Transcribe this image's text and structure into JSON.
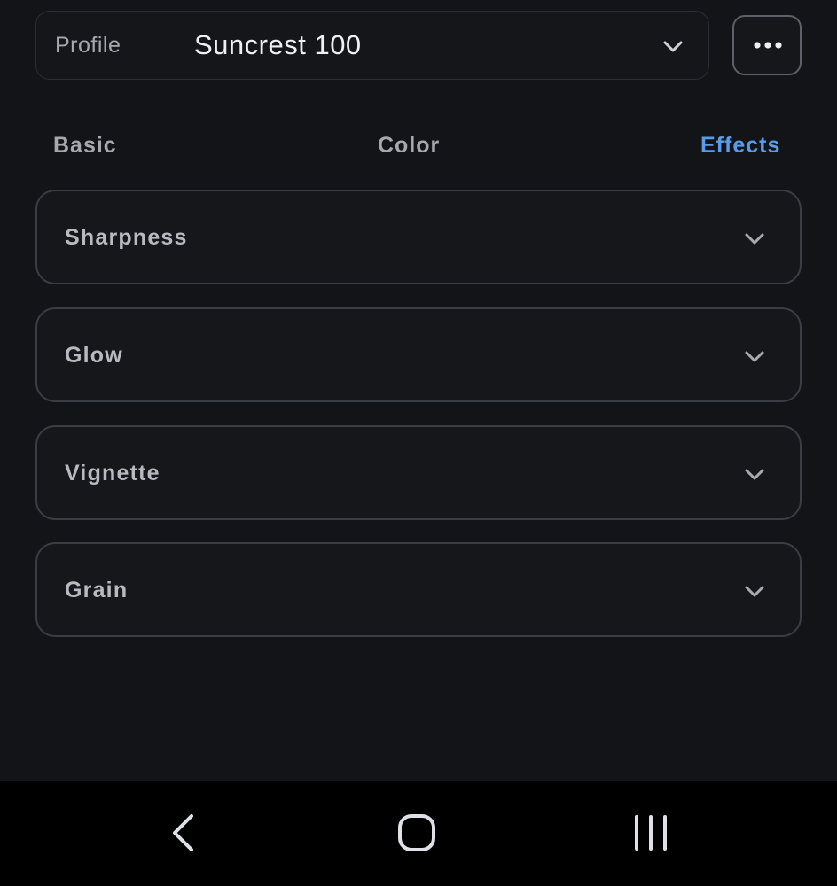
{
  "profile": {
    "label": "Profile",
    "value": "Suncrest 100",
    "more_icon": "more-horizontal-icon"
  },
  "tabs": [
    {
      "label": "Basic",
      "active": false
    },
    {
      "label": "Color",
      "active": false
    },
    {
      "label": "Effects",
      "active": true
    }
  ],
  "sections": [
    {
      "title": "Sharpness",
      "icon": "chevron-down-icon"
    },
    {
      "title": "Glow",
      "icon": "chevron-down-icon"
    },
    {
      "title": "Vignette",
      "icon": "chevron-down-icon"
    },
    {
      "title": "Grain",
      "icon": "chevron-down-icon"
    }
  ],
  "navbar": {
    "back_icon": "back-icon",
    "home_icon": "home-icon",
    "recents_icon": "recents-icon"
  },
  "colors": {
    "background": "#131418",
    "accent": "#5a9ce8",
    "border": "#3b3d44",
    "text_muted": "#a6a8b0"
  }
}
